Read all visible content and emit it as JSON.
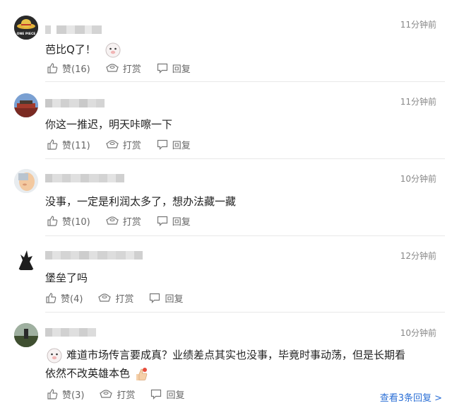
{
  "comments": [
    {
      "time": "11分钟前",
      "text": "芭比Q了！",
      "like": "赞(16)",
      "tip": "打赏",
      "reply": "回复"
    },
    {
      "time": "11分钟前",
      "text": "你这一推迟，明天咔嚓一下",
      "like": "赞(11)",
      "tip": "打赏",
      "reply": "回复"
    },
    {
      "time": "10分钟前",
      "text": "没事，一定是利润太多了，想办法藏一藏",
      "like": "赞(10)",
      "tip": "打赏",
      "reply": "回复"
    },
    {
      "time": "12分钟前",
      "text": "堡垒了吗",
      "like": "赞(4)",
      "tip": "打赏",
      "reply": "回复"
    },
    {
      "time": "10分钟前",
      "text_line1": "难道市场传言要成真？业绩差点其实也没事，毕竟时事动荡，但是长期看",
      "text_line2": "依然不改英雄本色",
      "like": "赞(3)",
      "tip": "打赏",
      "reply": "回复",
      "more": "查看3条回复 >"
    }
  ],
  "avatar1_text": "ONE PIECE",
  "colors": {
    "link": "#2b6fd6",
    "muted": "#888888"
  }
}
